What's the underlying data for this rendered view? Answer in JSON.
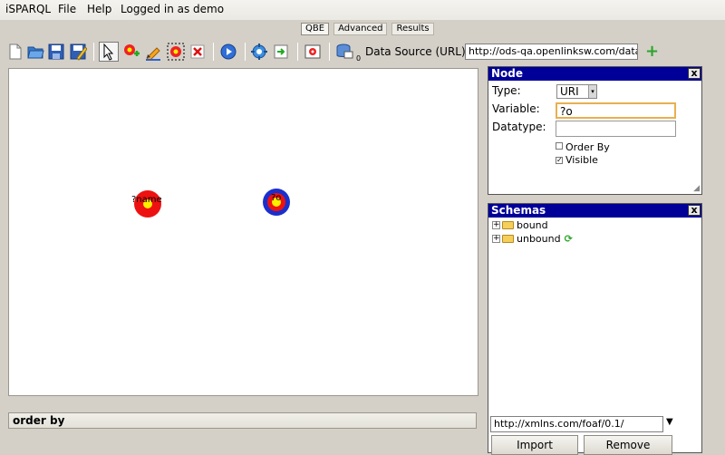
{
  "menubar": {
    "app": "iSPARQL",
    "file": "File",
    "help": "Help",
    "login": "Logged in as demo"
  },
  "tabs": [
    {
      "label": "QBE",
      "active": true
    },
    {
      "label": "Advanced"
    },
    {
      "label": "Results"
    }
  ],
  "toolbar": {
    "icons": [
      "new-document-icon",
      "open-folder-icon",
      "save-icon",
      "save-as-icon",
      "select-pointer-icon",
      "add-node-icon",
      "draw-edge-icon",
      "delete-selection-icon",
      "delete-icon",
      "run-icon",
      "generate-icon",
      "import-icon",
      "visualize-icon",
      "datasource-icon"
    ],
    "datasource_count": "0",
    "datasource_label": "Data Source (URL):",
    "datasource_value": "http://ods-qa.openlinksw.com/datas",
    "add_label": "+"
  },
  "canvas": {
    "nodes": [
      {
        "name": "?name",
        "color": "red"
      },
      {
        "name": "?o",
        "color": "blue"
      }
    ]
  },
  "orderby": {
    "label": "order by"
  },
  "node_panel": {
    "title": "Node",
    "close": "x",
    "type_label": "Type:",
    "type_value": "URI",
    "variable_label": "Variable:",
    "variable_value": "?o",
    "datatype_label": "Datatype:",
    "datatype_value": "",
    "order_by_label": "Order By",
    "order_by_checked": false,
    "visible_label": "Visible",
    "visible_checked": true
  },
  "schemas_panel": {
    "title": "Schemas",
    "close": "x",
    "items": [
      {
        "label": "bound"
      },
      {
        "label": "unbound"
      }
    ],
    "url_value": "http://xmlns.com/foaf/0.1/",
    "import_label": "Import",
    "remove_label": "Remove"
  },
  "colors": {
    "panel_title": "#000099",
    "accent_add": "#2aa52a",
    "node_red": "#ee1111",
    "node_blue": "#1a2fcc"
  }
}
